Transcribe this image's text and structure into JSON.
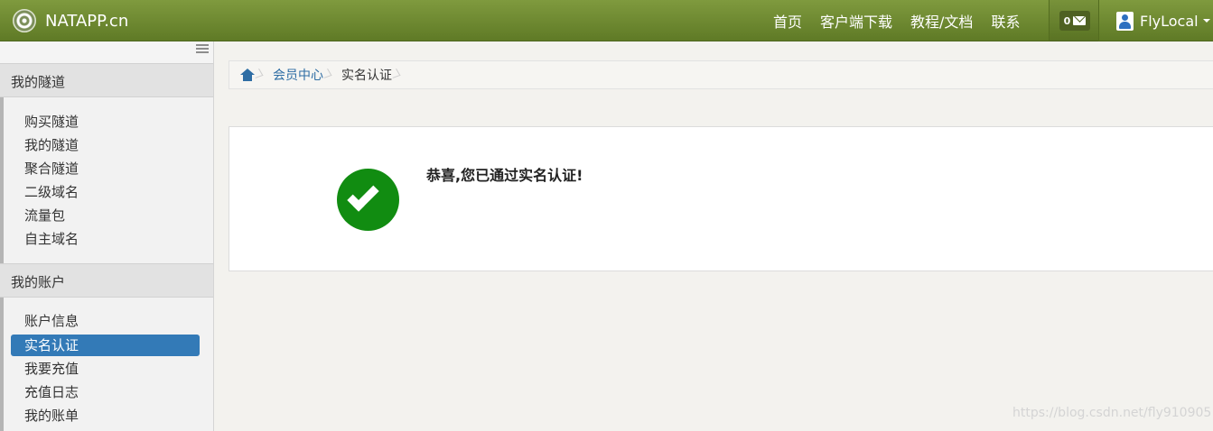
{
  "navbar": {
    "brand": "NATAPP.cn",
    "links": [
      "首页",
      "客户端下载",
      "教程/文档",
      "联系"
    ],
    "message_count": "0",
    "user_name": "FlyLocal"
  },
  "sidebar": {
    "sections": [
      {
        "title": "我的隧道",
        "items": [
          "购买隧道",
          "我的隧道",
          "聚合隧道",
          "二级域名",
          "流量包",
          "自主域名"
        ]
      },
      {
        "title": "我的账户",
        "items": [
          "账户信息",
          "实名认证",
          "我要充值",
          "充值日志",
          "我的账单"
        ]
      }
    ],
    "active_item": "实名认证"
  },
  "breadcrumb": {
    "link": "会员中心",
    "current": "实名认证"
  },
  "main": {
    "success_message": "恭喜,您已通过实名认证!"
  },
  "watermark": "https://blog.csdn.net/fly910905",
  "colors": {
    "navbar": "#6b8530",
    "active": "#337ab7",
    "success": "#118c11",
    "link": "#2e6da4"
  }
}
